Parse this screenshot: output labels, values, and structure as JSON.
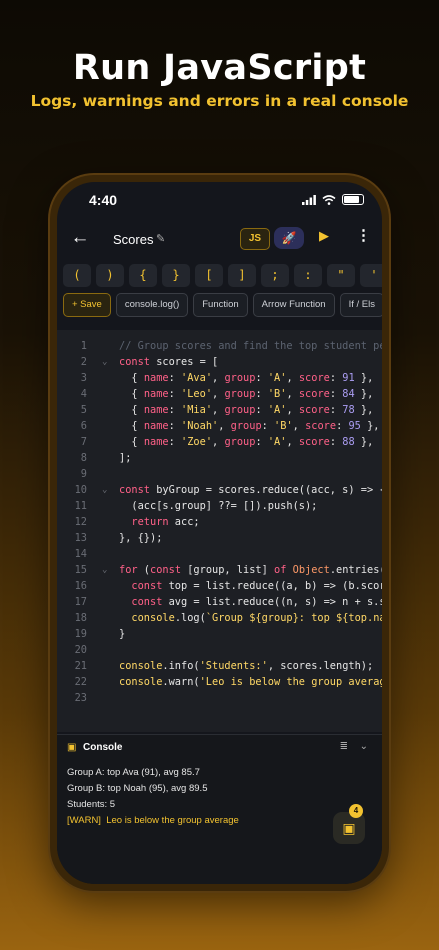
{
  "hero": {
    "title": "Run JavaScript",
    "subtitle": "Logs, warnings and errors in a real console"
  },
  "status_bar": {
    "time": "4:40"
  },
  "app_bar": {
    "back_icon": "back-arrow-icon",
    "file_name": "Scores",
    "edit_icon": "pencil-icon",
    "language_badge": "JS",
    "rocket_icon": "rocket-icon",
    "run_icon": "play-icon",
    "more_icon": "more-vert-icon"
  },
  "symbol_keys": [
    "(",
    ")",
    "{",
    "}",
    "[",
    "]",
    ";",
    ":",
    "\"",
    "'"
  ],
  "snippets": {
    "save": "+ Save",
    "items": [
      "console.log()",
      "Function",
      "Arrow Function",
      "If / Els"
    ]
  },
  "editor": {
    "lines": [
      "1",
      "2",
      "3",
      "4",
      "5",
      "6",
      "7",
      "8",
      "9",
      "10",
      "11",
      "12",
      "13",
      "14",
      "15",
      "16",
      "17",
      "18",
      "19",
      "20",
      "21",
      "22",
      "23"
    ]
  },
  "console": {
    "title": "Console",
    "icon": "terminal-icon",
    "clear_icon": "clear-list-icon",
    "collapse_icon": "chevron-down-icon",
    "logs": [
      "Group A: top Ava (91), avg 85.7",
      "Group B: top Noah (95), avg 89.5",
      "Students: 5"
    ],
    "warn_tag": "[WARN]",
    "warn_text": "Leo is below the group average",
    "fab_icon": "terminal-icon",
    "fab_badge": "4"
  },
  "colors": {
    "accent": "#f2c230",
    "keyword": "#ff6188",
    "string": "#ffd866",
    "number": "#ab9df2",
    "background": "#14161c"
  }
}
